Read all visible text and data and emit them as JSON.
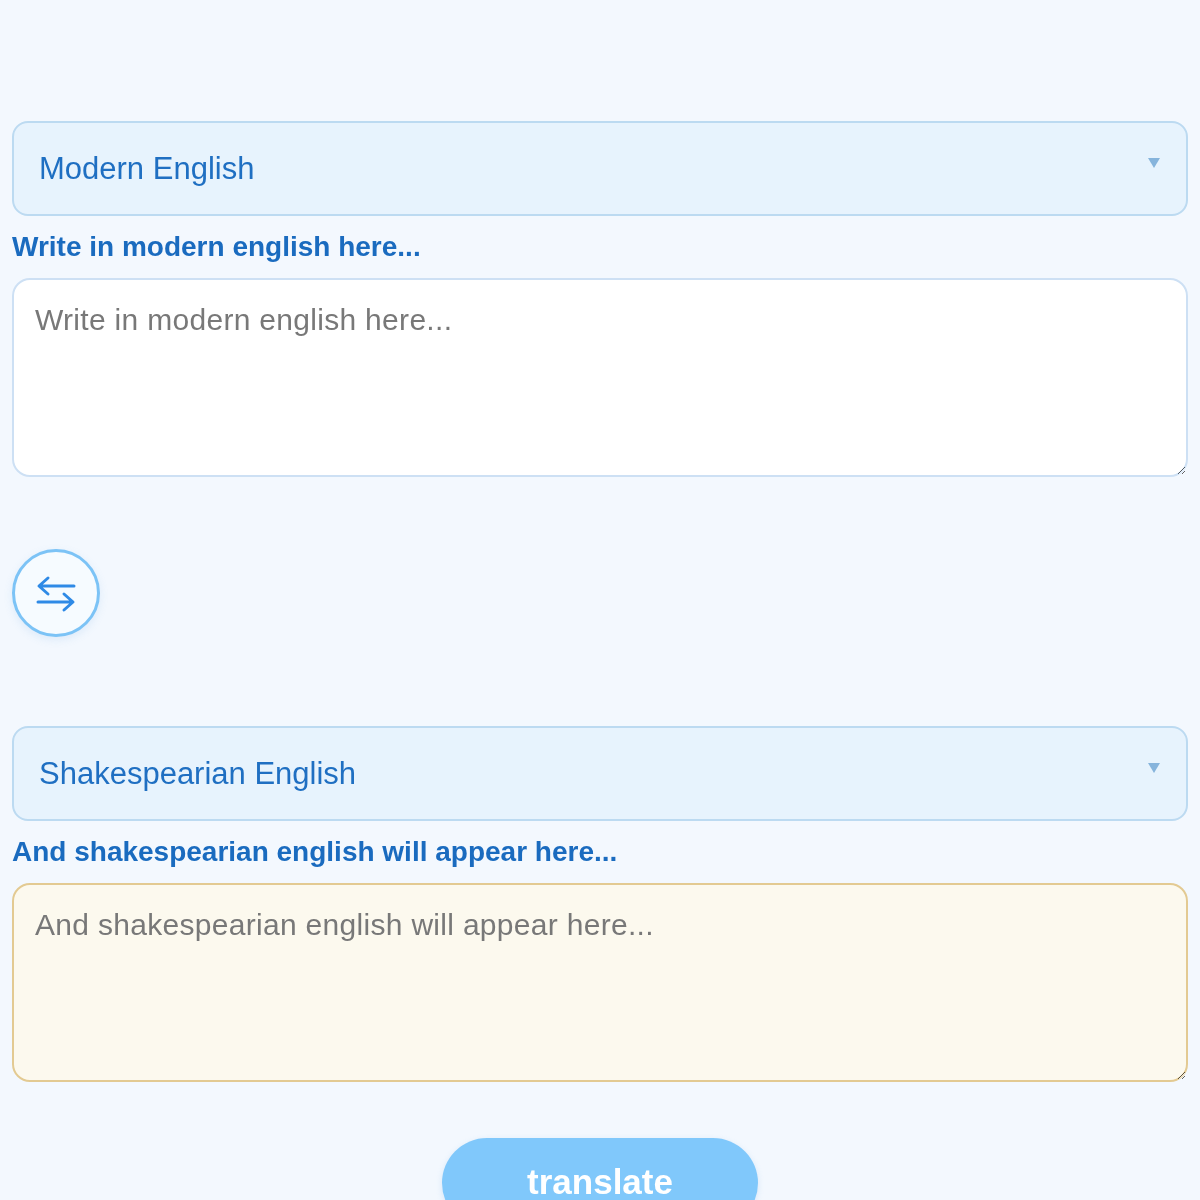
{
  "panels": [
    {
      "kind": "source",
      "language": "Modern English",
      "label": "Write in modern english here...",
      "placeholder": "Write in modern english here..."
    },
    {
      "kind": "target",
      "language": "Shakespearian English",
      "label": "And shakespearian english will appear here...",
      "placeholder": "And shakespearian english will appear here..."
    }
  ],
  "translate_button": {
    "label": "translate"
  }
}
